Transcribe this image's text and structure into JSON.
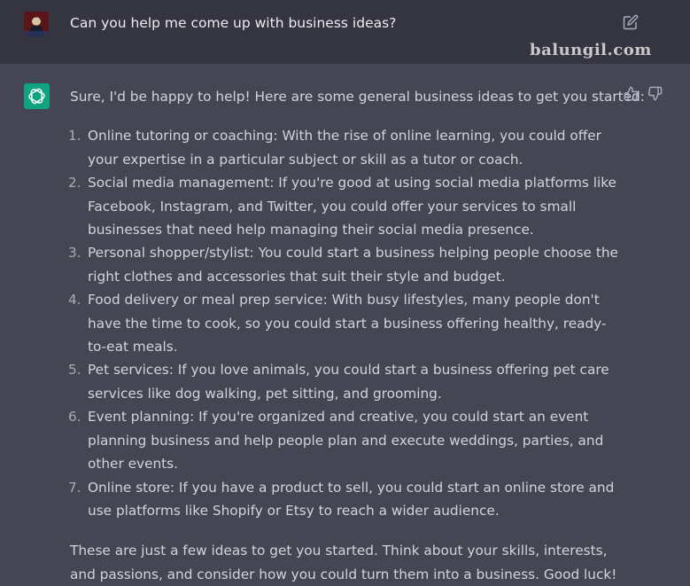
{
  "user_message": {
    "text": "Can you help me come up with business ideas?",
    "edit_icon": "edit-icon",
    "avatar": "user-avatar"
  },
  "watermark": "balungil.com",
  "assistant_message": {
    "avatar_icon": "openai-logo-icon",
    "intro": "Sure, I'd be happy to help! Here are some general business ideas to get you started:",
    "ideas": [
      {
        "num": "1.",
        "text": "Online tutoring or coaching: With the rise of online learning, you could offer your expertise in a particular subject or skill as a tutor or coach."
      },
      {
        "num": "2.",
        "text": "Social media management: If you're good at using social media platforms like Facebook, Instagram, and Twitter, you could offer your services to small businesses that need help managing their social media presence."
      },
      {
        "num": "3.",
        "text": "Personal shopper/stylist: You could start a business helping people choose the right clothes and accessories that suit their style and budget."
      },
      {
        "num": "4.",
        "text": "Food delivery or meal prep service: With busy lifestyles, many people don't have the time to cook, so you could start a business offering healthy, ready-to-eat meals."
      },
      {
        "num": "5.",
        "text": "Pet services: If you love animals, you could start a business offering pet care services like dog walking, pet sitting, and grooming."
      },
      {
        "num": "6.",
        "text": "Event planning: If you're organized and creative, you could start an event planning business and help people plan and execute weddings, parties, and other events."
      },
      {
        "num": "7.",
        "text": "Online store: If you have a product to sell, you could start an online store and use platforms like Shopify or Etsy to reach a wider audience."
      }
    ],
    "outro": "These are just a few ideas to get you started. Think about your skills, interests, and passions, and consider how you could turn them into a business. Good luck!",
    "thumbs_up_icon": "thumbs-up-icon",
    "thumbs_down_icon": "thumbs-down-icon"
  },
  "colors": {
    "user_bg": "#343541",
    "assistant_bg": "#444654",
    "gpt_green": "#10a37f",
    "text": "#d1d5db"
  }
}
